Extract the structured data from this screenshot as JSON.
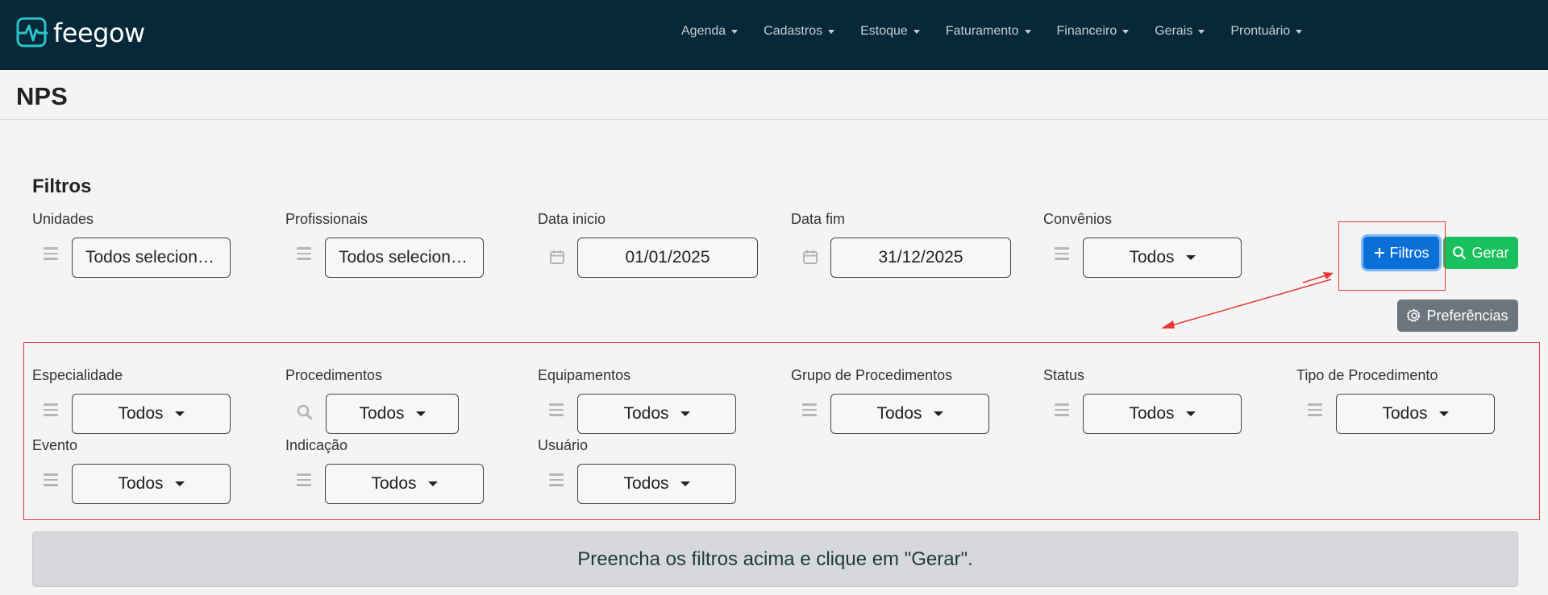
{
  "brand": {
    "name": "feegow"
  },
  "nav": {
    "items": [
      {
        "label": "Agenda"
      },
      {
        "label": "Cadastros"
      },
      {
        "label": "Estoque"
      },
      {
        "label": "Faturamento"
      },
      {
        "label": "Financeiro"
      },
      {
        "label": "Gerais"
      },
      {
        "label": "Prontuário"
      }
    ]
  },
  "page": {
    "title": "NPS"
  },
  "filters": {
    "title": "Filtros",
    "unidades": {
      "label": "Unidades",
      "value": "Todos selecion…",
      "icon": "list-icon"
    },
    "profissionais": {
      "label": "Profissionais",
      "value": "Todos selecion…",
      "icon": "list-icon"
    },
    "data_inicio": {
      "label": "Data inicio",
      "value": "01/01/2025",
      "icon": "calendar-icon"
    },
    "data_fim": {
      "label": "Data fim",
      "value": "31/12/2025",
      "icon": "calendar-icon"
    },
    "convenios": {
      "label": "Convênios",
      "value": "Todos",
      "icon": "list-icon"
    },
    "especialidade": {
      "label": "Especialidade",
      "value": "Todos",
      "icon": "list-icon"
    },
    "procedimentos": {
      "label": "Procedimentos",
      "value": "Todos",
      "icon": "search-icon"
    },
    "equipamentos": {
      "label": "Equipamentos",
      "value": "Todos",
      "icon": "list-icon"
    },
    "grupo_procedimentos": {
      "label": "Grupo de Procedimentos",
      "value": "Todos",
      "icon": "list-icon"
    },
    "status": {
      "label": "Status",
      "value": "Todos",
      "icon": "list-icon"
    },
    "tipo_procedimento": {
      "label": "Tipo de Procedimento",
      "value": "Todos",
      "icon": "list-icon"
    },
    "evento": {
      "label": "Evento",
      "value": "Todos",
      "icon": "list-icon"
    },
    "indicacao": {
      "label": "Indicação",
      "value": "Todos",
      "icon": "list-icon"
    },
    "usuario": {
      "label": "Usuário",
      "value": "Todos",
      "icon": "list-icon"
    }
  },
  "buttons": {
    "filtros": "Filtros",
    "gerar": "Gerar",
    "preferencias": "Preferências"
  },
  "banner": {
    "message": "Preencha os filtros acima e clique em \"Gerar\"."
  },
  "colors": {
    "navbar": "#062838",
    "primary": "#0b6fd8",
    "success": "#19c15d",
    "secondary": "#6c757d",
    "annotation": "#e53935"
  }
}
